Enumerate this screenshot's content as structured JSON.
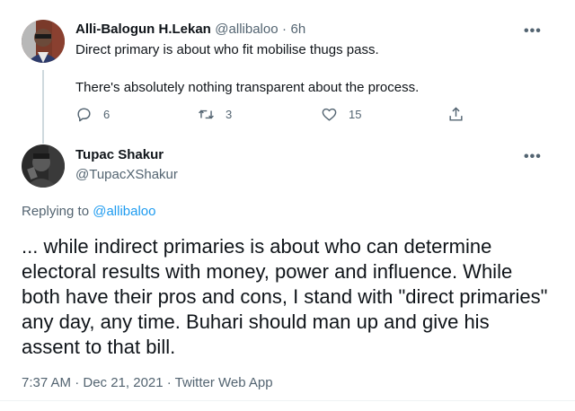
{
  "parent_tweet": {
    "author_name": "Alli-Balogun H.Lekan",
    "handle": "@allibaloo",
    "separator": "·",
    "time_ago": "6h",
    "more_label": "•••",
    "line1": "Direct primary is about who fit mobilise thugs pass.",
    "line2": "There's absolutely nothing transparent about the process.",
    "actions": {
      "reply_count": "6",
      "retweet_count": "3",
      "like_count": "15"
    }
  },
  "main_tweet": {
    "author_name": "Tupac Shakur",
    "handle": "@TupacXShakur",
    "more_label": "•••",
    "replying_label": "Replying to",
    "replying_handle": "@allibaloo",
    "text": "... while indirect primaries is about who can determine electoral results with money, power and influence. While both have their pros and cons, I stand with \"direct primaries\" any day, any time. Buhari should man up and give his assent to that bill.",
    "timestamp": "7:37 AM · Dec 21, 2021 · Twitter Web App"
  },
  "colors": {
    "text": "#0f1419",
    "muted": "#536471",
    "link": "#1d9bf0",
    "thread_line": "#cfd9de"
  },
  "icons": [
    "reply-icon",
    "retweet-icon",
    "like-icon",
    "share-icon",
    "more-icon"
  ]
}
